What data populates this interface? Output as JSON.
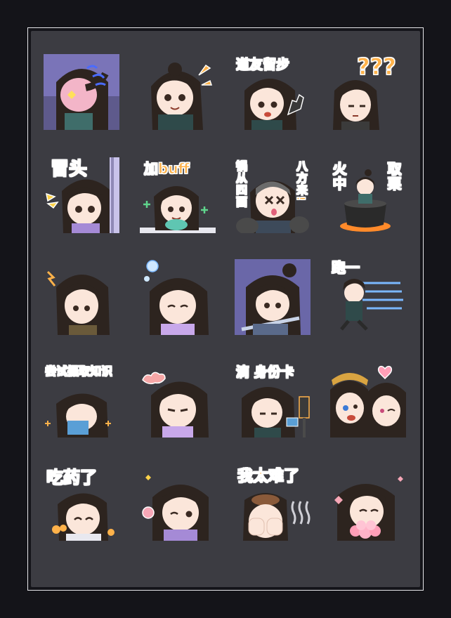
{
  "palette": {
    "background": "#141419",
    "panel": "#3c3c42",
    "frame": "#e6e6ea",
    "caption": "#ffb24a",
    "hair": "#2d241f",
    "skin": "#fbe6da"
  },
  "stickers": [
    {
      "caption": ""
    },
    {
      "caption": ""
    },
    {
      "caption": "道友留步"
    },
    {
      "caption": "???"
    },
    {
      "caption": "冒头"
    },
    {
      "caption": "加buff"
    },
    {
      "caption_left": "锅从四面",
      "caption_right": "八方来!"
    },
    {
      "caption_left": "火中",
      "caption_right": "取栗"
    },
    {
      "caption": ""
    },
    {
      "caption": ""
    },
    {
      "caption": ""
    },
    {
      "caption": "跑一"
    },
    {
      "caption": "尝试摄取知识"
    },
    {
      "caption": ""
    },
    {
      "caption": "滴 身份卡"
    },
    {
      "caption": ""
    },
    {
      "caption": "吃药了"
    },
    {
      "caption": ""
    },
    {
      "caption": "我太难了"
    },
    {
      "caption": ""
    }
  ]
}
